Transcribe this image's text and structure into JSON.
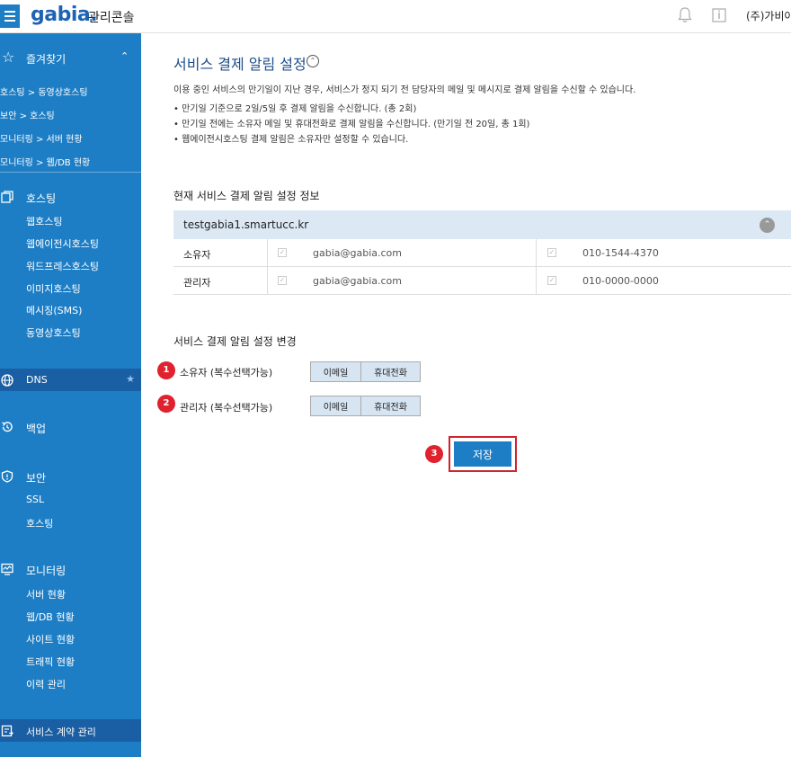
{
  "topbar": {
    "logo": "gabia.",
    "title": "관리콘솔",
    "company": "(주)가비아",
    "icons": [
      "bell-icon",
      "notice-icon"
    ]
  },
  "sidebar": {
    "favorites": {
      "label": "즐겨찾기"
    },
    "favorite_links": [
      "호스팅 > 동영상호스팅",
      "보안 > 호스팅",
      "모니터링 > 서버 현황",
      "모니터링 > 웹/DB 현황"
    ],
    "hosting": {
      "label": "호스팅",
      "items": [
        "웹호스팅",
        "웹에이전시호스팅",
        "워드프레스호스팅",
        "이미지호스팅",
        "메시징(SMS)",
        "동영상호스팅"
      ]
    },
    "dns": {
      "label": "DNS"
    },
    "backup": {
      "label": "백업"
    },
    "security": {
      "label": "보안",
      "items": [
        "SSL",
        "호스팅"
      ]
    },
    "monitoring": {
      "label": "모니터링",
      "items": [
        "서버 현황",
        "웹/DB 현황",
        "사이트 현황",
        "트래픽 현황",
        "이력 관리"
      ]
    },
    "contract": {
      "label": "서비스 계약 관리"
    }
  },
  "main": {
    "title": "서비스 결제 알림 설정",
    "description": "이용 중인 서비스의 만기일이 지난 경우, 서비스가 정지 되기 전 담당자의 메일 및 메시지로 결제 알림을 수신할 수 있습니다.",
    "bullets": [
      "만기일 기준으로 2일/5일 후 결제 알림을 수신합니다. (총 2회)",
      "만기일 전에는 소유자 메일 및 휴대전화로 결제 알림을 수신합니다. (만기일 전 20일, 총 1회)",
      "웹에이전시호스팅 결제 알림은 소유자만 설정할 수 있습니다."
    ],
    "info_heading": "현재 서비스 결제 알림 설정 정보",
    "info_table": {
      "domain": "testgabia1.smartucc.kr",
      "rows": [
        {
          "role": "소유자",
          "email": "gabia@gabia.com",
          "phone": "010-1544-4370"
        },
        {
          "role": "관리자",
          "email": "gabia@gabia.com",
          "phone": "010-0000-0000"
        }
      ]
    },
    "change_heading": "서비스 결제 알림 설정 변경",
    "change_rows": [
      {
        "step": "1",
        "label": "소유자 (복수선택가능)",
        "email_btn": "이메일",
        "phone_btn": "휴대전화"
      },
      {
        "step": "2",
        "label": "관리자 (복수선택가능)",
        "email_btn": "이메일",
        "phone_btn": "휴대전화"
      }
    ],
    "save": {
      "step": "3",
      "label": "저장"
    }
  },
  "colors": {
    "brand_blue": "#1e7ec5",
    "sidebar_active": "#1a5fa3",
    "highlight_red": "#e0222e",
    "table_header": "#dce9f5"
  }
}
